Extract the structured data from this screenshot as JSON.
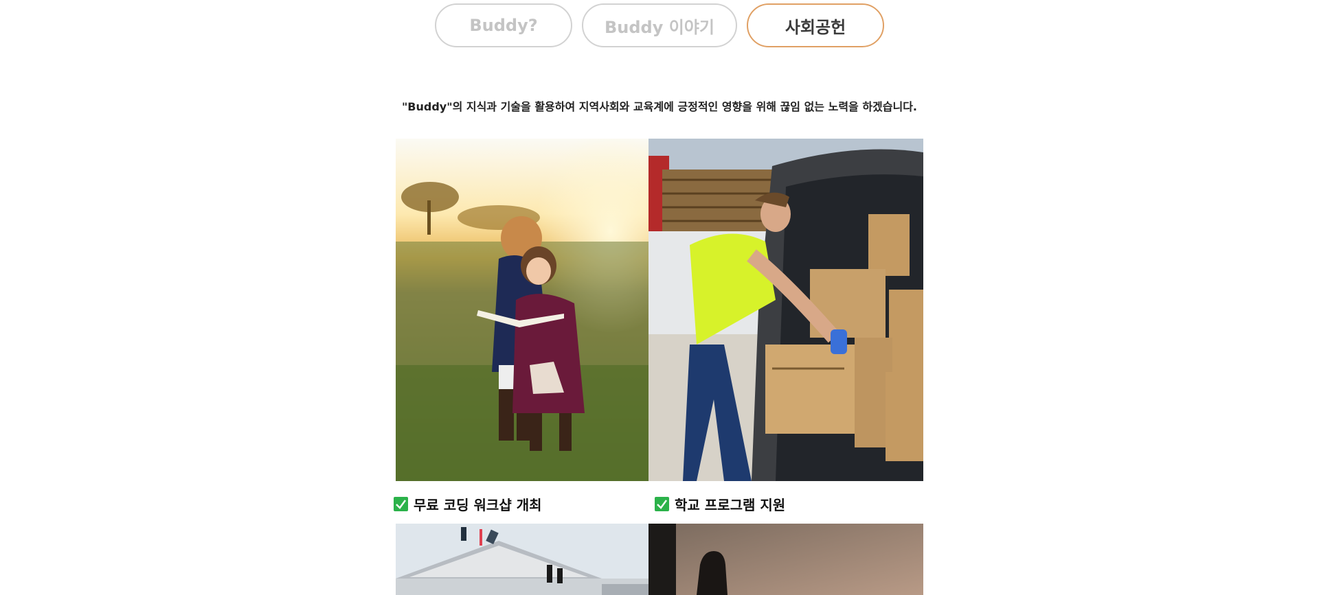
{
  "tabs": [
    {
      "label": "Buddy?",
      "active": false
    },
    {
      "label": "Buddy 이야기",
      "active": false
    },
    {
      "label": "사회공헌",
      "active": true
    }
  ],
  "intro_text": "\"Buddy\"의 지식과 기술을 활용하여 지역사회와 교육계에 긍정적인 영향을 위해 끊임 없는 노력을 하겠습니다.",
  "programs": [
    {
      "label": "무료 코딩 워크샵 개최",
      "icon": "check-box-icon"
    },
    {
      "label": "학교 프로그램 지원",
      "icon": "check-box-icon"
    }
  ],
  "colors": {
    "active_tab_border": "#e0a064",
    "inactive_tab_border": "#d2d2d2",
    "inactive_tab_text": "#c4c4c4",
    "check_green": "#2bb24a"
  }
}
